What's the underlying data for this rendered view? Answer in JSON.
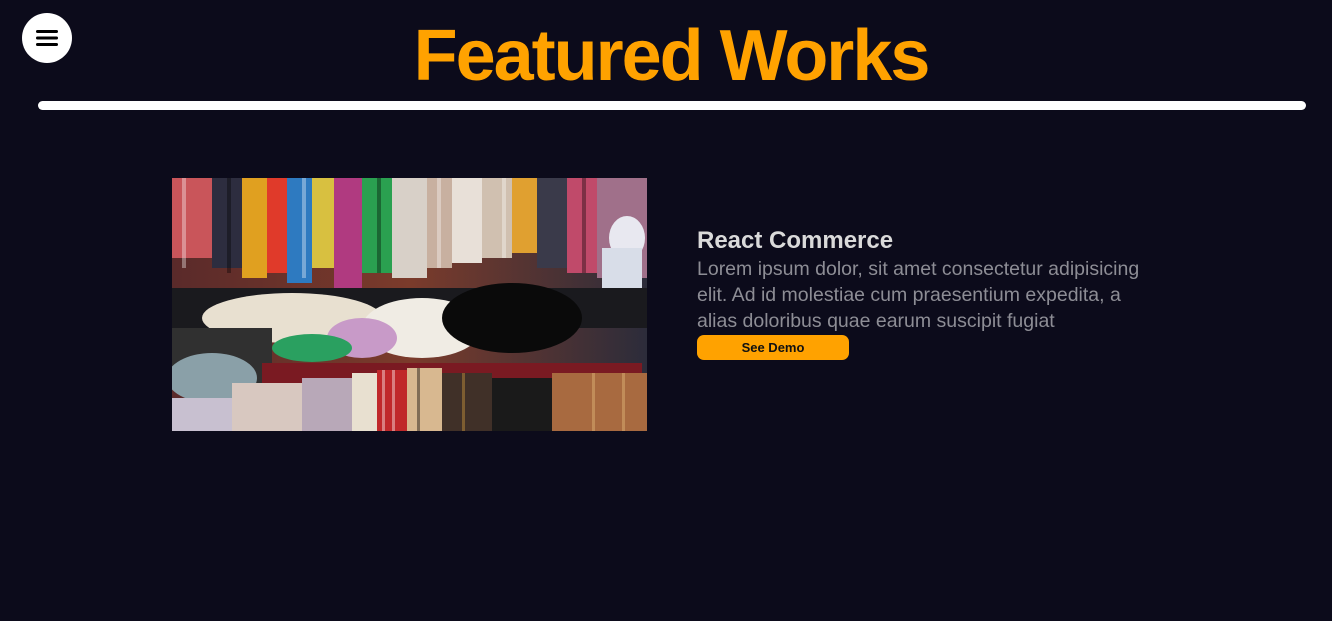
{
  "header": {
    "menu_icon": "hamburger-menu-icon",
    "title": "Featured Works"
  },
  "colors": {
    "background": "#0c0b1b",
    "accent": "#ffa200",
    "divider": "#ffffff"
  },
  "projects": [
    {
      "title": "React Commerce",
      "description": "Lorem ipsum dolor, sit amet consectetur adipisicing elit. Ad id molestiae cum praesentium expedita, a alias doloribus quae earum suscipit fugiat",
      "button_label": "See Demo"
    }
  ]
}
